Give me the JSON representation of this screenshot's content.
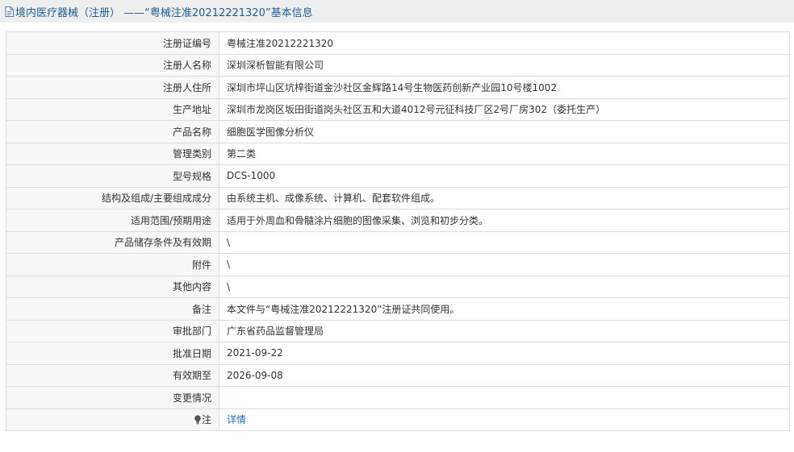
{
  "header": {
    "title": "境内医疗器械（注册） ——“粤械注准20212221320”基本信息",
    "icon": "document-icon",
    "link_color": "#1f5d96"
  },
  "rows": [
    {
      "label": "注册证编号",
      "value": "粤械注准20212221320"
    },
    {
      "label": "注册人名称",
      "value": "深圳深析智能有限公司"
    },
    {
      "label": "注册人住所",
      "value": "深圳市坪山区坑梓街道金沙社区金辉路14号生物医药创新产业园10号楼1002"
    },
    {
      "label": "生产地址",
      "value": "深圳市龙岗区坂田街道岗头社区五和大道4012号元征科技厂区2号厂房302（委托生产）"
    },
    {
      "label": "产品名称",
      "value": "细胞医学图像分析仪"
    },
    {
      "label": "管理类别",
      "value": "第二类"
    },
    {
      "label": "型号规格",
      "value": "DCS-1000"
    },
    {
      "label": "结构及组成/主要组成成分",
      "value": "由系统主机、成像系统、计算机、配套软件组成。"
    },
    {
      "label": "适用范围/预期用途",
      "value": "适用于外周血和骨髓涂片细胞的图像采集、浏览和初步分类。"
    },
    {
      "label": "产品储存条件及有效期",
      "value": "\\"
    },
    {
      "label": "附件",
      "value": "\\"
    },
    {
      "label": "其他内容",
      "value": "\\"
    },
    {
      "label": "备注",
      "value": "本文件与“粤械注准20212221320”注册证共同使用。"
    },
    {
      "label": "审批部门",
      "value": "广东省药品监督管理局"
    },
    {
      "label": "批准日期",
      "value": "2021-09-22"
    },
    {
      "label": "有效期至",
      "value": "2026-09-08"
    },
    {
      "label": "变更情况",
      "value": ""
    }
  ],
  "note": {
    "label": "注",
    "icon": "lightbulb-icon",
    "link_text": "详情",
    "link_color": "#1c6fbf"
  }
}
